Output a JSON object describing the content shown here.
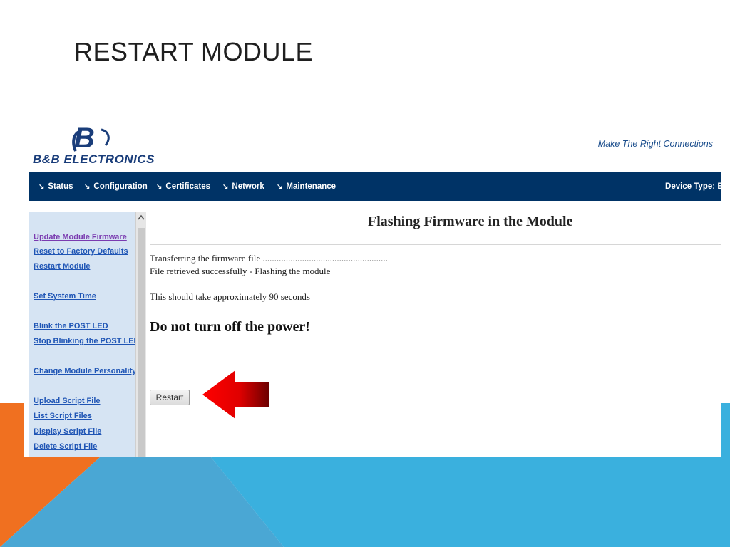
{
  "slide": {
    "title": "RESTART MODULE"
  },
  "header": {
    "logo_mark": "B",
    "logo_text_big": "B&B E",
    "logo_text_small": "LECTRONICS",
    "tagline": "Make The Right Connections"
  },
  "nav": {
    "items": [
      {
        "label": "Status"
      },
      {
        "label": "Configuration"
      },
      {
        "label": "Certificates"
      },
      {
        "label": "Network"
      },
      {
        "label": "Maintenance"
      }
    ],
    "arrow_glyph": "↘",
    "device_type": "Device Type: E"
  },
  "sidebar": {
    "links": [
      {
        "label": "Update Module Firmware",
        "visited": true
      },
      {
        "label": "Reset to Factory Defaults",
        "visited": false
      },
      {
        "label": "Restart Module",
        "visited": false
      },
      {
        "label": "Set System Time",
        "visited": false
      },
      {
        "label": "Blink the POST LED",
        "visited": false
      },
      {
        "label": "Stop Blinking the POST LED",
        "visited": false
      },
      {
        "label": "Change Module Personality",
        "visited": false
      },
      {
        "label": "Upload Script File",
        "visited": false
      },
      {
        "label": "List Script Files",
        "visited": false
      },
      {
        "label": "Display Script File",
        "visited": false
      },
      {
        "label": "Delete Script File",
        "visited": false
      }
    ]
  },
  "main": {
    "title": "Flashing Firmware in the Module",
    "line1": "Transferring the firmware file ......................................................",
    "line2": "File retrieved successfully - Flashing the module",
    "line3": "This should take approximately 90 seconds",
    "warning": "Do not turn off the power!",
    "restart_label": "Restart"
  },
  "colors": {
    "nav_bg": "#003366",
    "sidebar_bg": "#D6E4F3",
    "accent_orange": "#F07020",
    "accent_blue": "#3AB0DE",
    "arrow_red": "#E00000"
  },
  "icons": {
    "scroll_up": "▲"
  }
}
